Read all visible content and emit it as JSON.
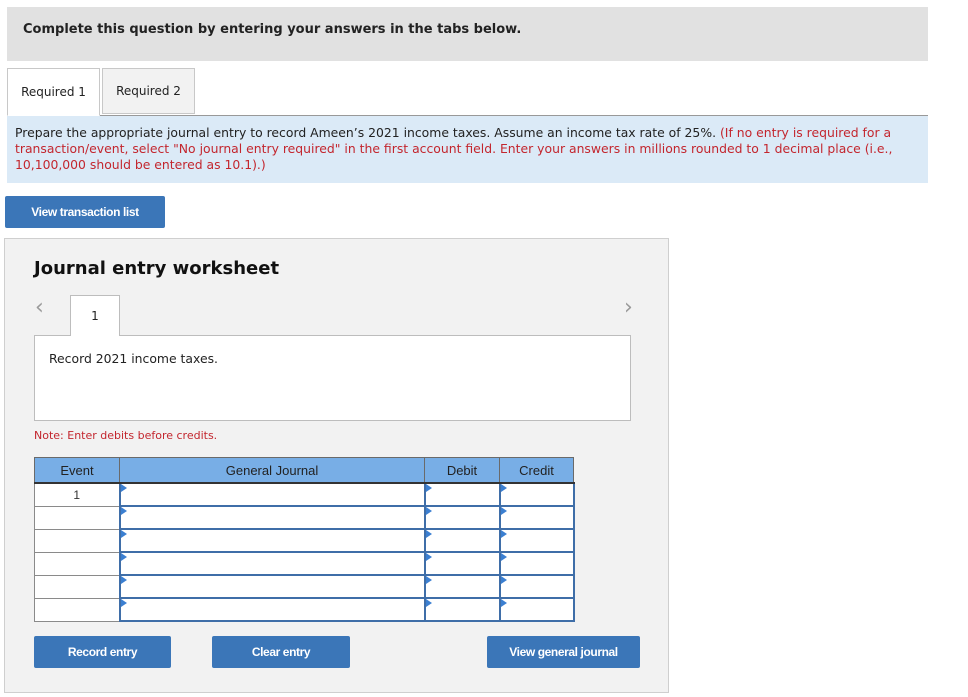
{
  "header": {
    "instruction": "Complete this question by entering your answers in the tabs below."
  },
  "tabs": [
    {
      "label": "Required 1",
      "active": true
    },
    {
      "label": "Required 2",
      "active": false
    }
  ],
  "prompt": {
    "text": "Prepare the appropriate journal entry to record Ameen’s 2021 income taxes. Assume an income tax rate of 25%. ",
    "note": "(If no entry is required for a transaction/event, select \"No journal entry required\" in the first account field. Enter your answers in millions rounded to 1 decimal place (i.e., 10,100,000 should be entered as 10.1).)"
  },
  "buttons": {
    "view_transaction_list": "View transaction list",
    "record_entry": "Record entry",
    "clear_entry": "Clear entry",
    "view_general_journal": "View general journal"
  },
  "worksheet": {
    "title": "Journal entry worksheet",
    "nav_prev": "‹",
    "nav_next": "›",
    "entry_tab": "1",
    "description": "Record 2021 income taxes.",
    "note": "Note: Enter debits before credits.",
    "columns": [
      "Event",
      "General Journal",
      "Debit",
      "Credit"
    ],
    "rows": [
      {
        "event": "1",
        "account": "",
        "debit": "",
        "credit": ""
      },
      {
        "event": "",
        "account": "",
        "debit": "",
        "credit": ""
      },
      {
        "event": "",
        "account": "",
        "debit": "",
        "credit": ""
      },
      {
        "event": "",
        "account": "",
        "debit": "",
        "credit": ""
      },
      {
        "event": "",
        "account": "",
        "debit": "",
        "credit": ""
      },
      {
        "event": "",
        "account": "",
        "debit": "",
        "credit": ""
      }
    ]
  }
}
